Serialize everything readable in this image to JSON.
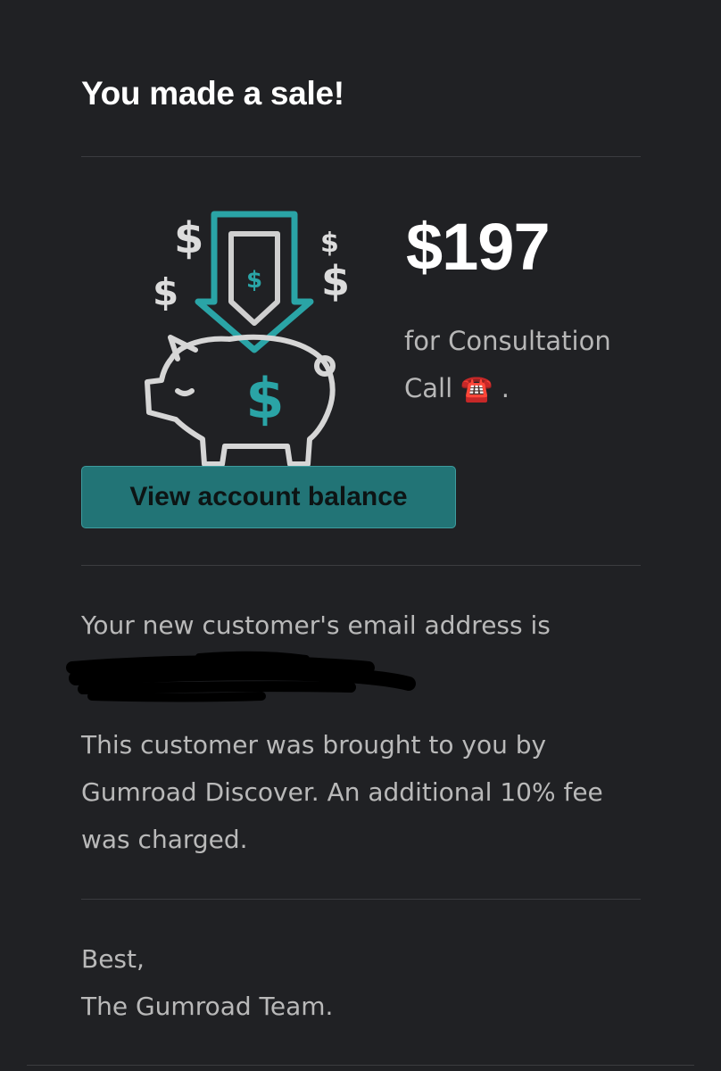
{
  "email": {
    "heading": "You made a sale!",
    "sale": {
      "amount": "$197",
      "product_text": "for Consultation Call",
      "product_emoji": "☎️",
      "trailing": "."
    },
    "button_label": "View account balance",
    "customer_email_text": "Your new customer's email address is",
    "discover_note": "This customer was brought to you by Gumroad Discover. An additional 10% fee was charged.",
    "signoff": {
      "line1": "Best,",
      "line2": "The Gumroad Team."
    }
  },
  "colors": {
    "background": "#202124",
    "accent": "#2aa4a6",
    "button": "#227476",
    "text": "#b9b9b9",
    "heading": "#ffffff"
  },
  "icons": [
    "piggy-bank-icon",
    "dollar-icon",
    "arrow-down-icon",
    "telephone-icon"
  ]
}
